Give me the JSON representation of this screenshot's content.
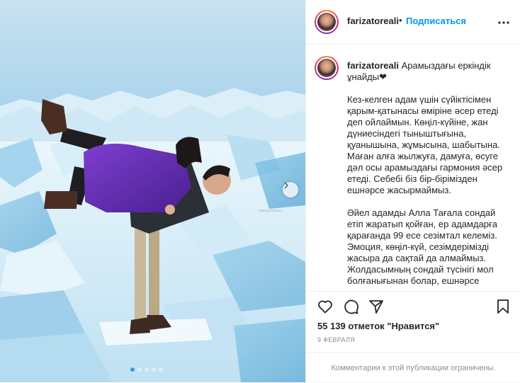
{
  "post": {
    "username": "farizatoreali",
    "follow_label": "Подписаться",
    "header_separator": "•",
    "caption_title": "Арамыздағы еркіндік ұнайды❤",
    "caption_paragraphs": [
      "Кез-келген адам үшін сүйіктісімен қарым-қатынасы өміріне әсер етеді деп ойлаймын. Көңіл-күйіне, жан дүниесіндегі тыныштығына, қуанышына, жұмысына, шабытына. Маған алға жылжуға, дамуға, өсуге дәл осы арамыздағы гармония әсер етеді. Себебі біз бір-бірімізден ешнәрсе жасырмаймыз.",
      "Әйел адамды Алла Тағала сондай етіп жаратып қойған, ер адамдарға қарағанда 99 есе сезімтал келеміз. Эмоция, көңіл-күй, сезімдерімізді жасыра да сақтай да алмаймыз. Жолдасымның сондай түсінігі мол болғанығынан болар, ешнәрсе"
    ],
    "likes_text": "55 139 отметок \"Нравится\"",
    "date_text": "9 ФЕВРАЛЯ",
    "comments_disabled_text": "Комментарии к этой публикации ограничены."
  },
  "carousel": {
    "total_slides": 5,
    "active_slide": 1
  },
  "photo_watermark": "FARIZATOREALI",
  "icons": {
    "more": "more-horizontal-icon",
    "like": "heart-icon",
    "comment": "comment-bubble-icon",
    "share": "paper-plane-icon",
    "save": "bookmark-icon",
    "next": "chevron-right-icon"
  },
  "colors": {
    "follow_blue": "#0095f6",
    "text": "#262626",
    "muted": "#8e8e8e",
    "border": "#efefef",
    "active_dot": "#3897f0"
  }
}
